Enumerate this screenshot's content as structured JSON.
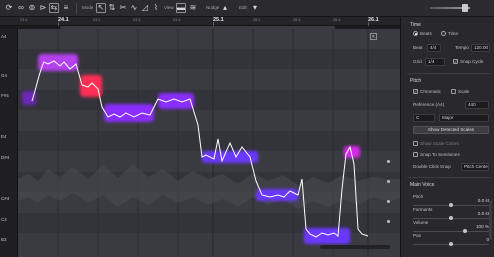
{
  "toolbar": {
    "mode_label": "Mode",
    "view_label": "View",
    "nudge_label": "Nudge",
    "edit_label": "Edit"
  },
  "ruler": {
    "bars": [
      "24.1",
      "25.1",
      "26.1"
    ],
    "beats": [
      "23.4",
      "24.2",
      "24.3",
      "24.4",
      "25.2",
      "25.3",
      "25.4"
    ]
  },
  "keys": [
    "A4",
    "G4",
    "F#4",
    "E4",
    "D#4",
    "C#4",
    "C4",
    "B3"
  ],
  "inspector": {
    "time": {
      "title": "Time",
      "beats_label": "Beats",
      "time_label": "Time",
      "beat_label": "Beat",
      "signature": "4/4",
      "tempo_label": "Tempo",
      "tempo_value": "120.00",
      "grid_label": "Grid",
      "grid_value": "1/4",
      "snap_cycle_label": "Snap Cycle"
    },
    "pitch": {
      "title": "Pitch",
      "chromatic_label": "Chromatic",
      "scale_label": "Scale",
      "reference_label": "Reference (A4)",
      "reference_value": "440",
      "key_value": "C",
      "mode_value": "Major",
      "show_scales_button": "Show Detected Scales",
      "show_scale_colors_label": "Show Scale Colors",
      "snap_semitones_label": "Snap To Semitones",
      "double_click_label": "Double Click Snap",
      "double_click_value": "Pitch Center"
    },
    "main_voice": {
      "title": "Main Voice",
      "pitch_label": "Pitch",
      "pitch_value": "0.0 st",
      "formants_label": "Formants",
      "formants_value": "0.0 st",
      "volume_label": "Volume",
      "volume_value": "100 %",
      "pan_label": "Pan",
      "pan_value": "0"
    }
  },
  "colors": {
    "note_purple": "#8a2fff",
    "note_magenta": "#d42be8",
    "note_red": "#ff2e55",
    "note_blue": "#4a46ff",
    "pitch_line": "#ffffff",
    "editor_bg": "#3a3a41"
  }
}
